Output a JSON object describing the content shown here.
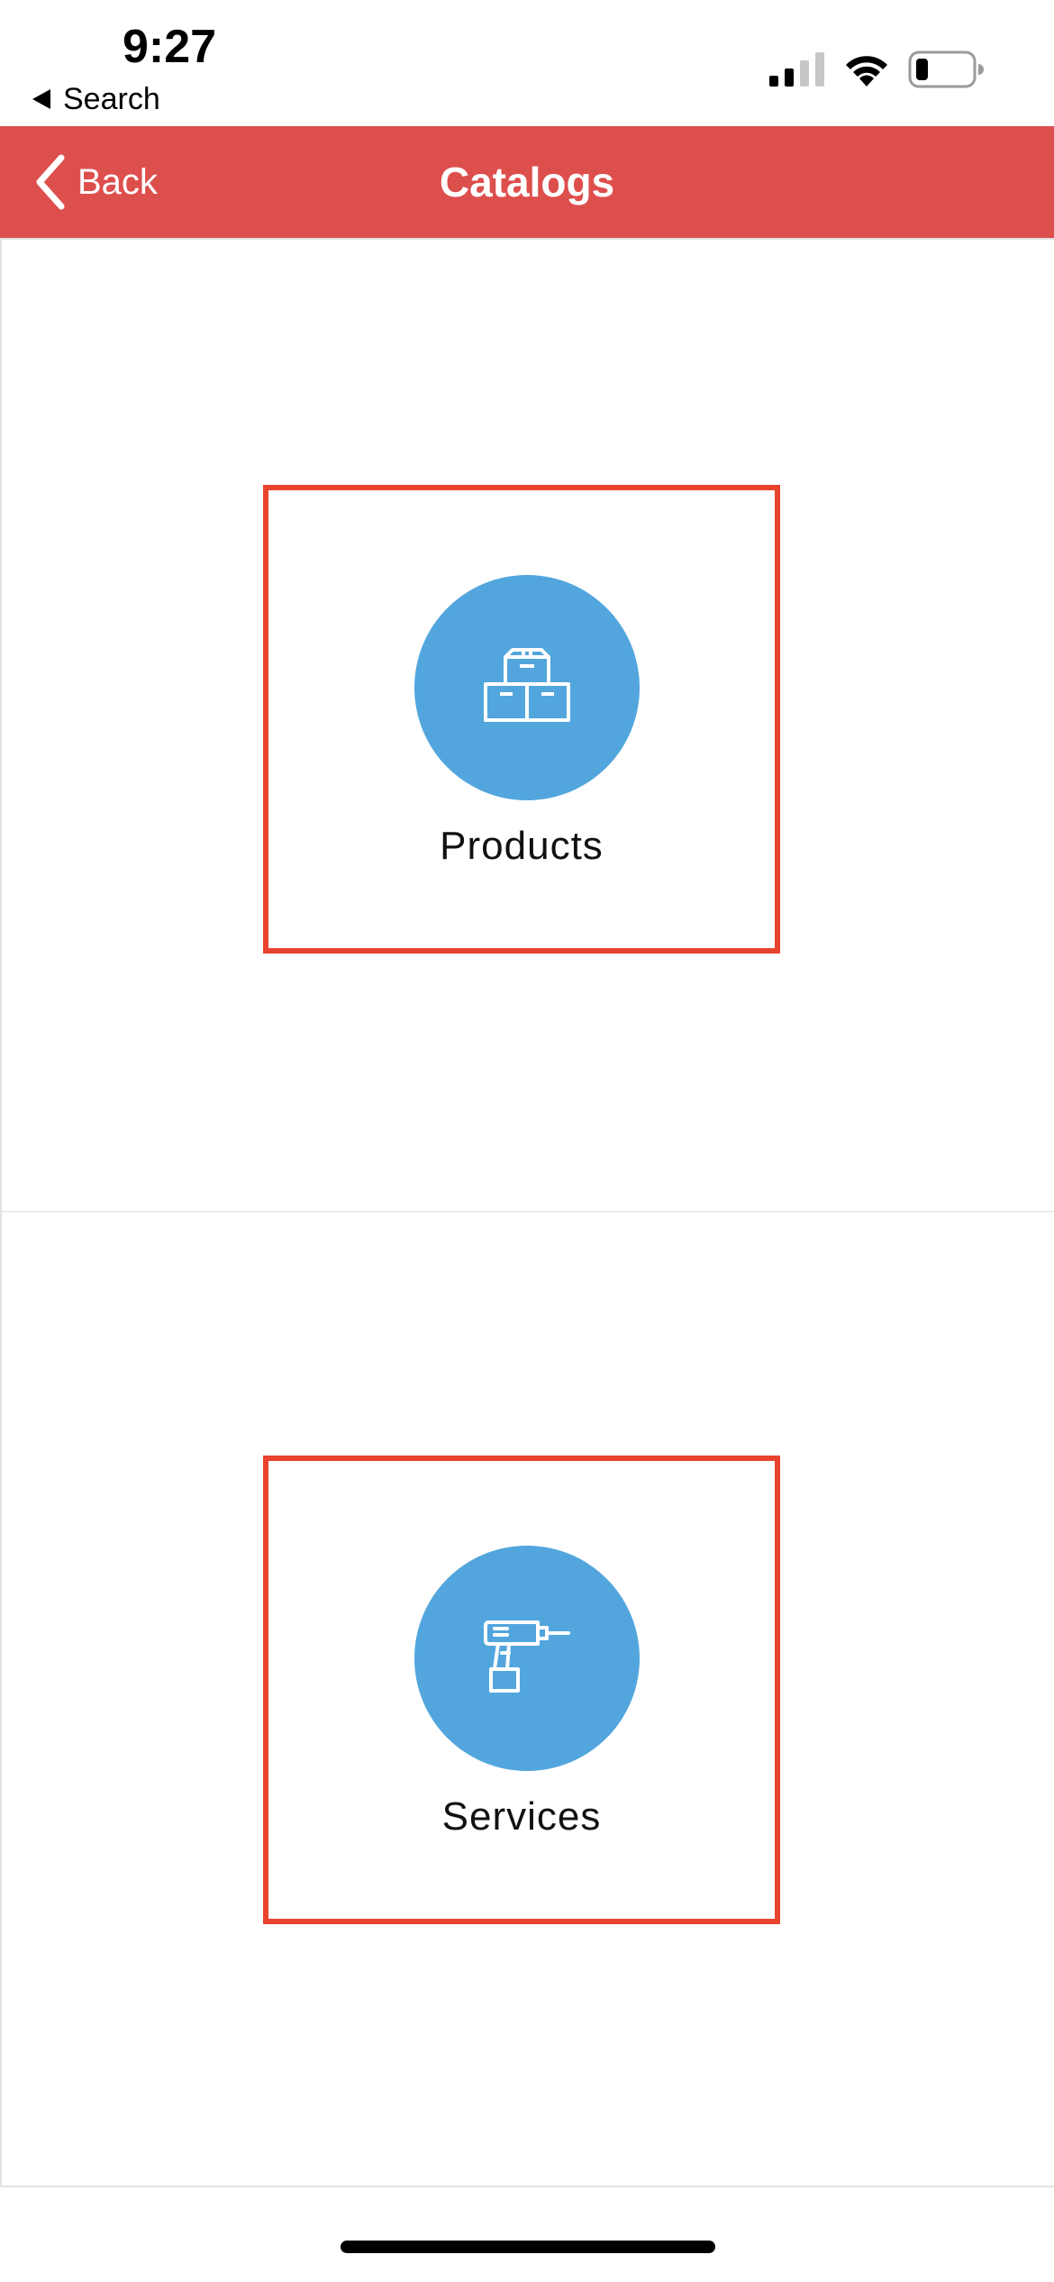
{
  "status_bar": {
    "time": "9:27",
    "back_app_label": "Search",
    "icons": [
      "cellular-signal-icon",
      "wifi-icon",
      "battery-icon"
    ]
  },
  "nav": {
    "back_label": "Back",
    "title": "Catalogs",
    "background_color": "#dd4f4d"
  },
  "catalogs": [
    {
      "label": "Products",
      "icon": "boxes-icon"
    },
    {
      "label": "Services",
      "icon": "drill-icon"
    }
  ],
  "colors": {
    "circle": "#52a6dd",
    "highlight_border": "#e8432e"
  }
}
